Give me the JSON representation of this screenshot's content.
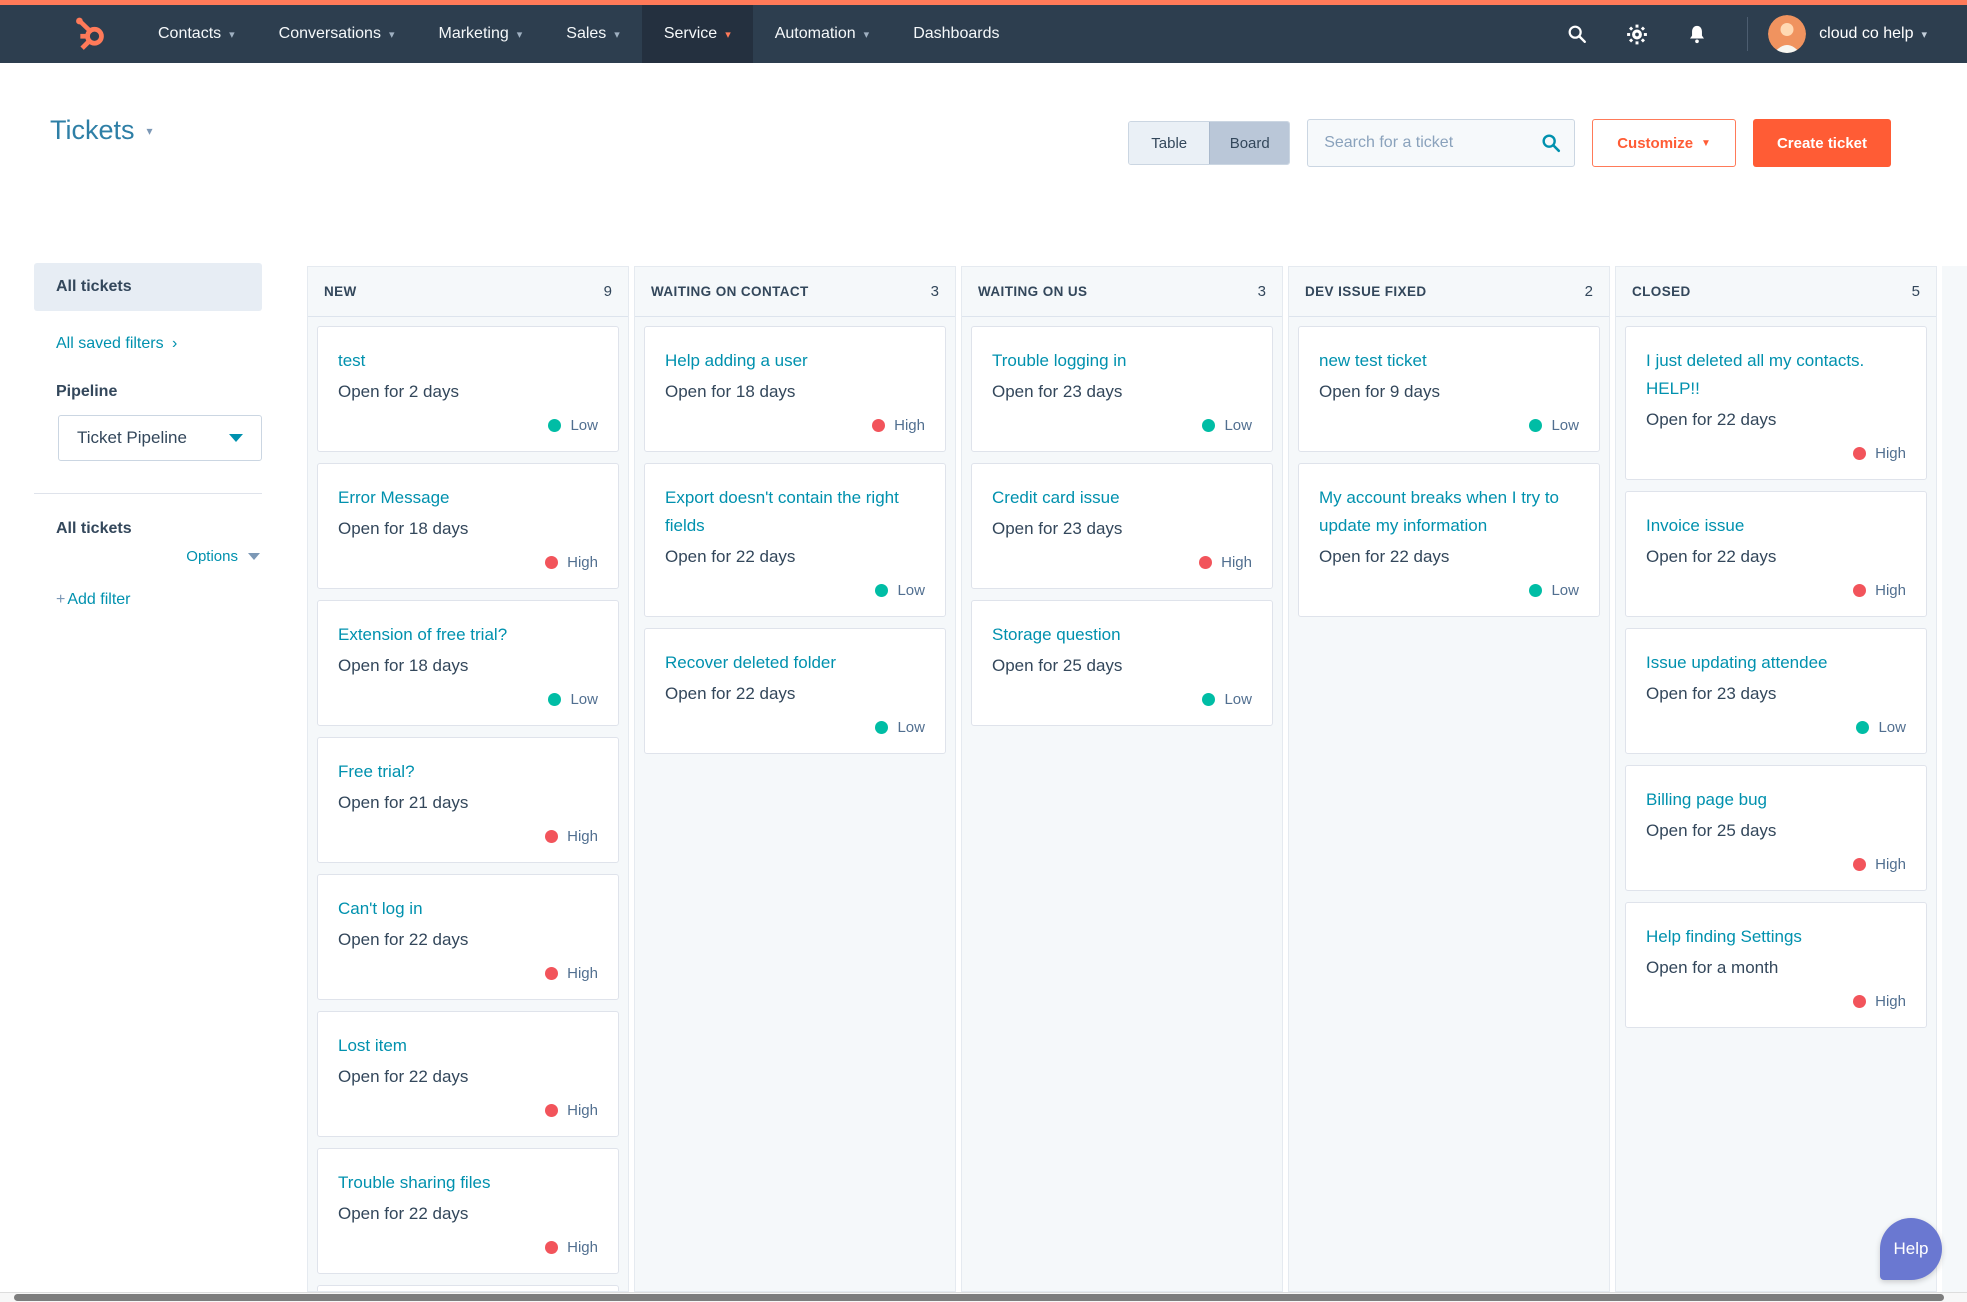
{
  "colors": {
    "top_strip": "#ff7a59",
    "accent_orange": "#ff5c35",
    "link_teal": "#0091ae",
    "low_green": "#00bda5",
    "high_red": "#f2545b",
    "nav_bg": "#2d3e4f",
    "text_dark": "#33475b",
    "help_purple": "#6a78d1"
  },
  "nav": {
    "items": [
      {
        "label": "Contacts",
        "caret": true,
        "active": false
      },
      {
        "label": "Conversations",
        "caret": true,
        "active": false
      },
      {
        "label": "Marketing",
        "caret": true,
        "active": false
      },
      {
        "label": "Sales",
        "caret": true,
        "active": false
      },
      {
        "label": "Service",
        "caret": true,
        "active": true
      },
      {
        "label": "Automation",
        "caret": true,
        "active": false
      },
      {
        "label": "Dashboards",
        "caret": false,
        "active": false
      }
    ],
    "user_name": "cloud co help"
  },
  "header": {
    "title": "Tickets",
    "toggle": {
      "table": "Table",
      "board": "Board",
      "selected": "Board"
    },
    "search_placeholder": "Search for a ticket",
    "customize_label": "Customize",
    "create_label": "Create ticket"
  },
  "sidebar": {
    "selected_view": "All tickets",
    "saved_filters_link": "All saved filters",
    "pipeline_label": "Pipeline",
    "pipeline_value": "Ticket Pipeline",
    "list_title": "All tickets",
    "options_label": "Options",
    "add_filter_label": "Add filter"
  },
  "board": {
    "columns": [
      {
        "name": "NEW",
        "count": "9",
        "overflow_card": true,
        "cards": [
          {
            "title": "test",
            "open": "Open for 2 days",
            "priority": "Low"
          },
          {
            "title": "Error Message",
            "open": "Open for 18 days",
            "priority": "High"
          },
          {
            "title": "Extension of free trial?",
            "open": "Open for 18 days",
            "priority": "Low"
          },
          {
            "title": "Free trial?",
            "open": "Open for 21 days",
            "priority": "High"
          },
          {
            "title": "Can't log in",
            "open": "Open for 22 days",
            "priority": "High"
          },
          {
            "title": "Lost item",
            "open": "Open for 22 days",
            "priority": "High"
          },
          {
            "title": "Trouble sharing files",
            "open": "Open for 22 days",
            "priority": "High"
          }
        ]
      },
      {
        "name": "WAITING ON CONTACT",
        "count": "3",
        "overflow_card": false,
        "cards": [
          {
            "title": "Help adding a user",
            "open": "Open for 18 days",
            "priority": "High"
          },
          {
            "title": "Export doesn't contain the right fields",
            "open": "Open for 22 days",
            "priority": "Low"
          },
          {
            "title": "Recover deleted folder",
            "open": "Open for 22 days",
            "priority": "Low"
          }
        ]
      },
      {
        "name": "WAITING ON US",
        "count": "3",
        "overflow_card": false,
        "cards": [
          {
            "title": "Trouble logging in",
            "open": "Open for 23 days",
            "priority": "Low"
          },
          {
            "title": "Credit card issue",
            "open": "Open for 23 days",
            "priority": "High"
          },
          {
            "title": "Storage question",
            "open": "Open for 25 days",
            "priority": "Low"
          }
        ]
      },
      {
        "name": "DEV ISSUE FIXED",
        "count": "2",
        "overflow_card": false,
        "cards": [
          {
            "title": "new test ticket",
            "open": "Open for 9 days",
            "priority": "Low"
          },
          {
            "title": "My account breaks when I try to update my information",
            "open": "Open for 22 days",
            "priority": "Low"
          }
        ]
      },
      {
        "name": "CLOSED",
        "count": "5",
        "overflow_card": false,
        "cards": [
          {
            "title": "I just deleted all my contacts. HELP!!",
            "open": "Open for 22 days",
            "priority": "High"
          },
          {
            "title": "Invoice issue",
            "open": "Open for 22 days",
            "priority": "High"
          },
          {
            "title": "Issue updating attendee",
            "open": "Open for 23 days",
            "priority": "Low"
          },
          {
            "title": "Billing page bug",
            "open": "Open for 25 days",
            "priority": "High"
          },
          {
            "title": "Help finding Settings",
            "open": "Open for a month",
            "priority": "High"
          }
        ]
      }
    ],
    "partial_column": true
  },
  "help": {
    "label": "Help"
  }
}
